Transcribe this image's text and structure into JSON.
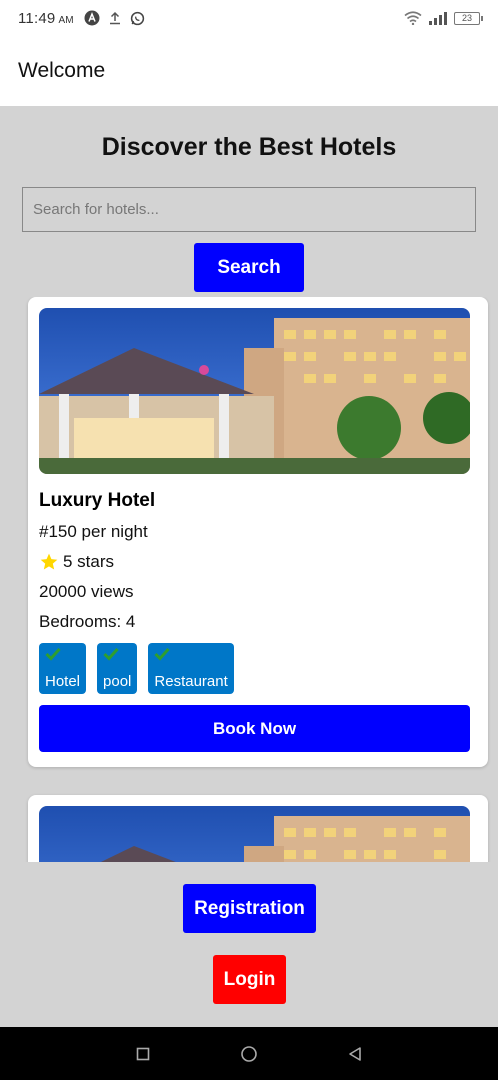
{
  "status_bar": {
    "time": "11:49",
    "ampm": "AM",
    "battery": "23",
    "left_icons": [
      "app-a-icon",
      "upload-icon",
      "whatsapp-icon"
    ],
    "right_icons": [
      "wifi-icon",
      "signal-icon",
      "battery-icon"
    ]
  },
  "app_bar": {
    "title": "Welcome"
  },
  "main": {
    "heading": "Discover the Best Hotels",
    "search": {
      "placeholder": "Search for hotels...",
      "value": "",
      "button_label": "Search"
    }
  },
  "hotels": [
    {
      "name": "Luxury Hotel",
      "price": "#150 per night",
      "rating": "5 stars",
      "views": "20000 views",
      "bedrooms": "Bedrooms: 4",
      "tags": [
        "Hotel",
        "pool",
        "Restaurant"
      ],
      "book_label": "Book Now"
    },
    {
      "name": "",
      "price": "",
      "rating": "",
      "views": "",
      "bedrooms": "",
      "tags": [],
      "book_label": ""
    }
  ],
  "footer": {
    "registration_label": "Registration",
    "login_label": "Login"
  },
  "colors": {
    "primary": "#0000ff",
    "danger": "#ff0000",
    "tag": "#0077c8",
    "background": "#d3d3d3",
    "star": "#ffd700",
    "check": "#2e9e2e"
  }
}
